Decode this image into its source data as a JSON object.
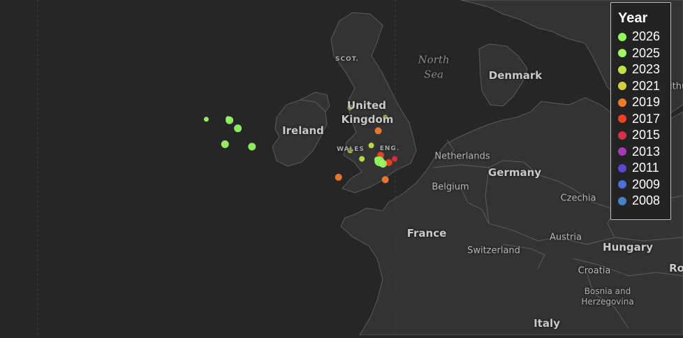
{
  "map": {
    "country_labels": [
      "Ireland",
      "United",
      "Kingdom",
      "Netherlands",
      "Germany",
      "Belgium",
      "France",
      "Denmark",
      "Czechia",
      "Austria",
      "Hungary",
      "Switzerland",
      "Croatia",
      "Bosnia and",
      "Herzegovina",
      "Italy",
      "Ro",
      "Lithu"
    ],
    "region_labels": [
      "SCOT.",
      "WALES",
      "ENG."
    ],
    "sea_labels": [
      "North",
      "Sea"
    ],
    "colors": {
      "background": "#262626",
      "land": "#333333",
      "border": "#5c5c5c"
    }
  },
  "legend": {
    "title": "Year",
    "items": [
      {
        "year": "2026",
        "color": "#90f561"
      },
      {
        "year": "2025",
        "color": "#9ff564"
      },
      {
        "year": "2023",
        "color": "#bde34a"
      },
      {
        "year": "2021",
        "color": "#d6cf3c"
      },
      {
        "year": "2019",
        "color": "#f07a2a"
      },
      {
        "year": "2017",
        "color": "#ee4122"
      },
      {
        "year": "2015",
        "color": "#da2f47"
      },
      {
        "year": "2013",
        "color": "#a33bb4"
      },
      {
        "year": "2011",
        "color": "#5a46d1"
      },
      {
        "year": "2009",
        "color": "#4a6fd6"
      },
      {
        "year": "2008",
        "color": "#4782c4"
      }
    ]
  },
  "points": [
    {
      "year": "2026",
      "lon": -8.22,
      "lat": 54.45
    },
    {
      "year": "2026",
      "lon": -8.16,
      "lat": 54.38
    },
    {
      "year": "2025",
      "lon": -9.15,
      "lat": 54.42
    },
    {
      "year": "2026",
      "lon": -7.8,
      "lat": 54.05
    },
    {
      "year": "2025",
      "lon": -8.35,
      "lat": 53.4
    },
    {
      "year": "2026",
      "lon": -7.2,
      "lat": 53.3
    },
    {
      "year": "2023",
      "lon": -3.0,
      "lat": 54.9
    },
    {
      "year": "2023",
      "lon": -1.5,
      "lat": 54.5
    },
    {
      "year": "2019",
      "lon": -1.8,
      "lat": 53.95
    },
    {
      "year": "2023",
      "lon": -2.1,
      "lat": 53.35
    },
    {
      "year": "2023",
      "lon": -3.0,
      "lat": 53.15
    },
    {
      "year": "2023",
      "lon": -2.5,
      "lat": 52.8
    },
    {
      "year": "2019",
      "lon": -3.5,
      "lat": 52.05
    },
    {
      "year": "2019",
      "lon": -1.5,
      "lat": 51.95
    },
    {
      "year": "2017",
      "lon": -1.7,
      "lat": 52.95
    },
    {
      "year": "2015",
      "lon": -1.1,
      "lat": 52.8
    },
    {
      "year": "2017",
      "lon": -1.35,
      "lat": 52.65
    },
    {
      "year": "2023",
      "lon": -1.85,
      "lat": 52.78
    },
    {
      "year": "2026",
      "lon": -1.75,
      "lat": 52.7
    },
    {
      "year": "2025",
      "lon": -1.6,
      "lat": 52.6
    }
  ]
}
